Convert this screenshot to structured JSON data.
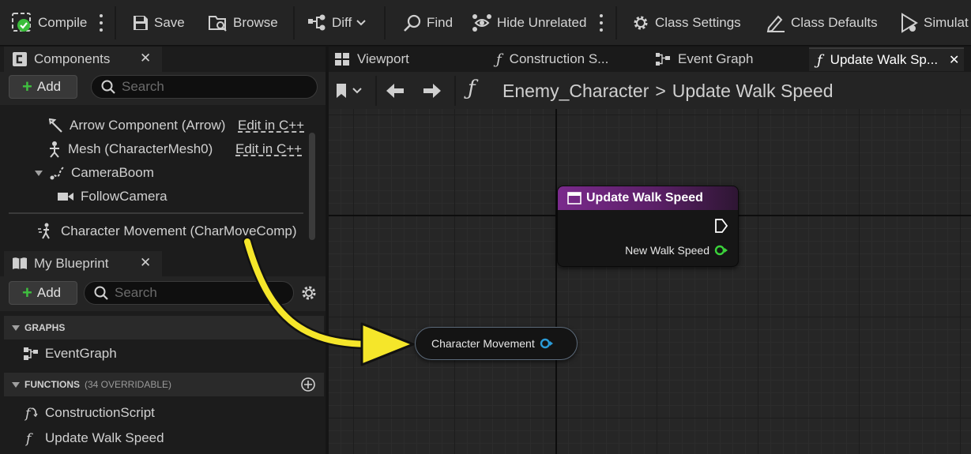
{
  "toolbar": {
    "compile": "Compile",
    "save": "Save",
    "browse": "Browse",
    "diff": "Diff",
    "find": "Find",
    "hide_unrelated": "Hide Unrelated",
    "class_settings": "Class Settings",
    "class_defaults": "Class Defaults",
    "simulate": "Simulat"
  },
  "components_panel": {
    "title": "Components",
    "add": "Add",
    "search_placeholder": "Search",
    "items": [
      {
        "label": "Arrow Component (Arrow)",
        "edit": "Edit in C++"
      },
      {
        "label": "Mesh (CharacterMesh0)",
        "edit": "Edit in C++"
      },
      {
        "label": "CameraBoom"
      },
      {
        "label": "FollowCamera"
      },
      {
        "label": "Character Movement (CharMoveComp)"
      }
    ]
  },
  "blueprint_panel": {
    "title": "My Blueprint",
    "add": "Add",
    "search_placeholder": "Search",
    "graphs_header": "GRAPHS",
    "graphs": [
      "EventGraph"
    ],
    "functions_header": "FUNCTIONS",
    "functions_sub": "(34 OVERRIDABLE)",
    "functions": [
      "ConstructionScript",
      "Update Walk Speed"
    ]
  },
  "doc_tabs": [
    "Viewport",
    "Construction S...",
    "Event Graph",
    "Update Walk Sp..."
  ],
  "breadcrumb": {
    "class": "Enemy_Character",
    "sep": ">",
    "function": "Update Walk Speed"
  },
  "graph": {
    "function_node_title": "Update Walk Speed",
    "function_node_pin": "New Walk Speed",
    "variable_node_label": "Character Movement"
  },
  "colors": {
    "node_header": "#7a2a8c",
    "float_pin": "#3bd33b",
    "object_pin": "#2a9bd8",
    "annotation_arrow": "#f5e62a"
  }
}
